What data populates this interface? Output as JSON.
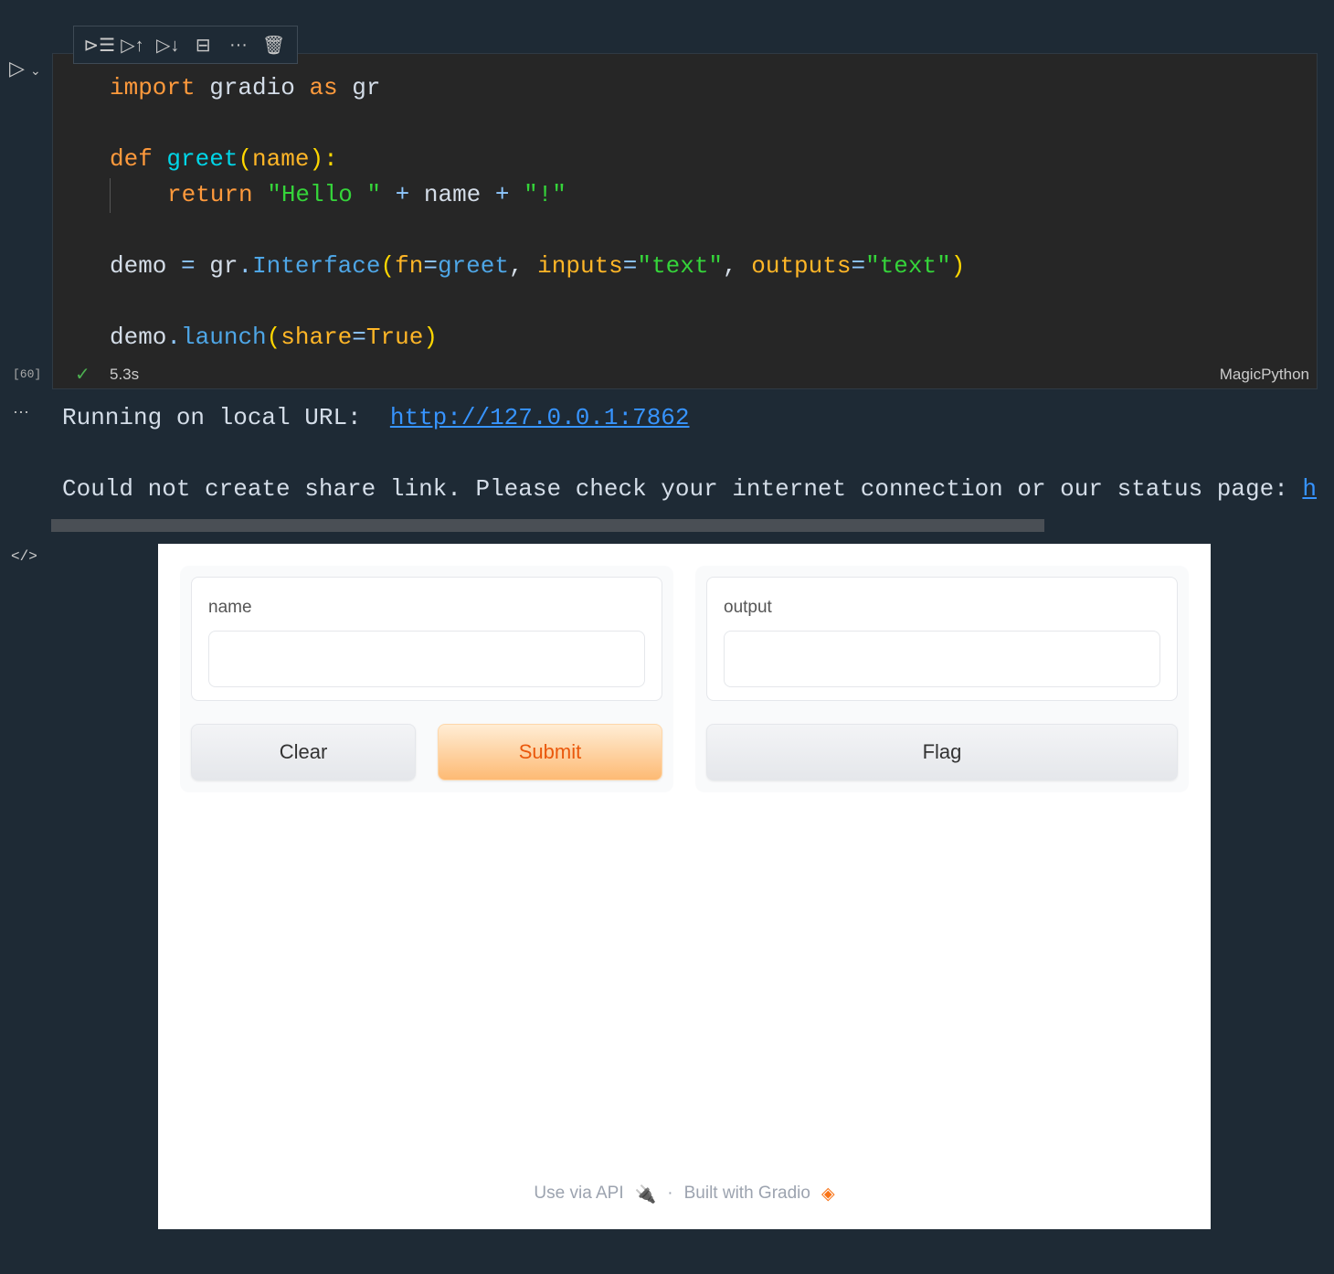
{
  "toolbar": {
    "icons": [
      "run-by-line-icon",
      "execute-above-icon",
      "execute-below-icon",
      "split-cell-icon",
      "more-icon",
      "delete-icon"
    ]
  },
  "cell": {
    "exec_count": "[60]",
    "duration": "5.3s",
    "language": "MagicPython",
    "lines": {
      "l1": {
        "a": "import",
        "b": " gradio ",
        "c": "as",
        "d": " gr"
      },
      "l2": {
        "a": "def ",
        "b": "greet",
        "c": "(",
        "d": "name",
        "e": "):"
      },
      "l3": {
        "a": "return ",
        "b": "\"Hello \"",
        "c": " + ",
        "d": "name",
        "e": " + ",
        "f": "\"!\""
      },
      "l4": {
        "a": "demo ",
        "b": "= ",
        "c": "gr",
        "d": ".",
        "e": "Interface",
        "f": "(",
        "g": "fn",
        "h": "=",
        "i": "greet",
        ",": ", ",
        "j": "inputs",
        "k": "=",
        "l": "\"text\"",
        "m": ", ",
        "n": "outputs",
        "o": "=",
        "p": "\"text\"",
        "q": ")"
      },
      "l5": {
        "a": "demo",
        "b": ".",
        "c": "launch",
        "d": "(",
        "e": "share",
        "f": "=",
        "g": "True",
        "h": ")"
      }
    }
  },
  "output": {
    "line1_prefix": "Running on local URL:  ",
    "line1_link": "http://127.0.0.1:7862",
    "line2": "Could not create share link. Please check your internet connection or our status page: ",
    "line2_link": "h"
  },
  "gradio": {
    "input_label": "name",
    "input_value": "",
    "output_label": "output",
    "output_value": "",
    "clear": "Clear",
    "submit": "Submit",
    "flag": "Flag",
    "footer_api": "Use via API",
    "footer_sep": "·",
    "footer_built": "Built with Gradio"
  },
  "colors": {
    "accent": "#ea580c",
    "link": "#3794ff"
  }
}
